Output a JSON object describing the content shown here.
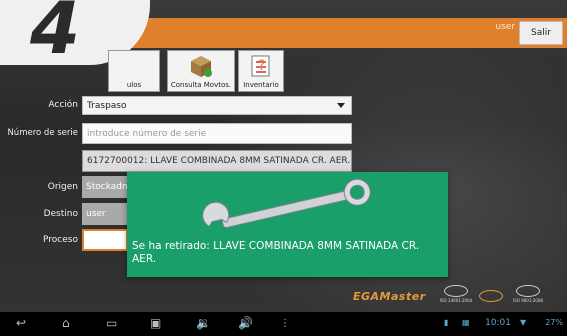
{
  "header": {
    "user": "user",
    "logout_label": "Salir"
  },
  "step_badge": "4",
  "toolbar": {
    "items": [
      {
        "label": "ulos",
        "icon": "articles-icon"
      },
      {
        "label": "Consulta Movtos.",
        "icon": "box-icon"
      },
      {
        "label": "Inventario",
        "icon": "checklist-icon"
      }
    ]
  },
  "form": {
    "accion_label": "Acción",
    "accion_value": "Traspaso",
    "serie_label": "Número de serie",
    "serie_placeholder": "introduce número de serie",
    "suggestion": "6172700012: LLAVE COMBINADA 8MM SATINADA CR. AER.",
    "origen_label": "Origen",
    "origen_value": "Stockadm",
    "destino_label": "Destino",
    "destino_value": "user",
    "proceso_label": "Proceso",
    "proceso_value": ""
  },
  "toast": {
    "message": "Se ha retirado:  LLAVE COMBINADA 8MM SATINADA CR. AER.",
    "icon": "wrench-icon"
  },
  "footer": {
    "brand": "EGAMaster",
    "certs": [
      "ISO 14001:2004",
      "",
      "ISO 9001:2008"
    ]
  },
  "status_bar": {
    "time": "10:01",
    "battery": "27%"
  },
  "colors": {
    "accent": "#e07f2c",
    "toast": "#1a9e6a"
  }
}
